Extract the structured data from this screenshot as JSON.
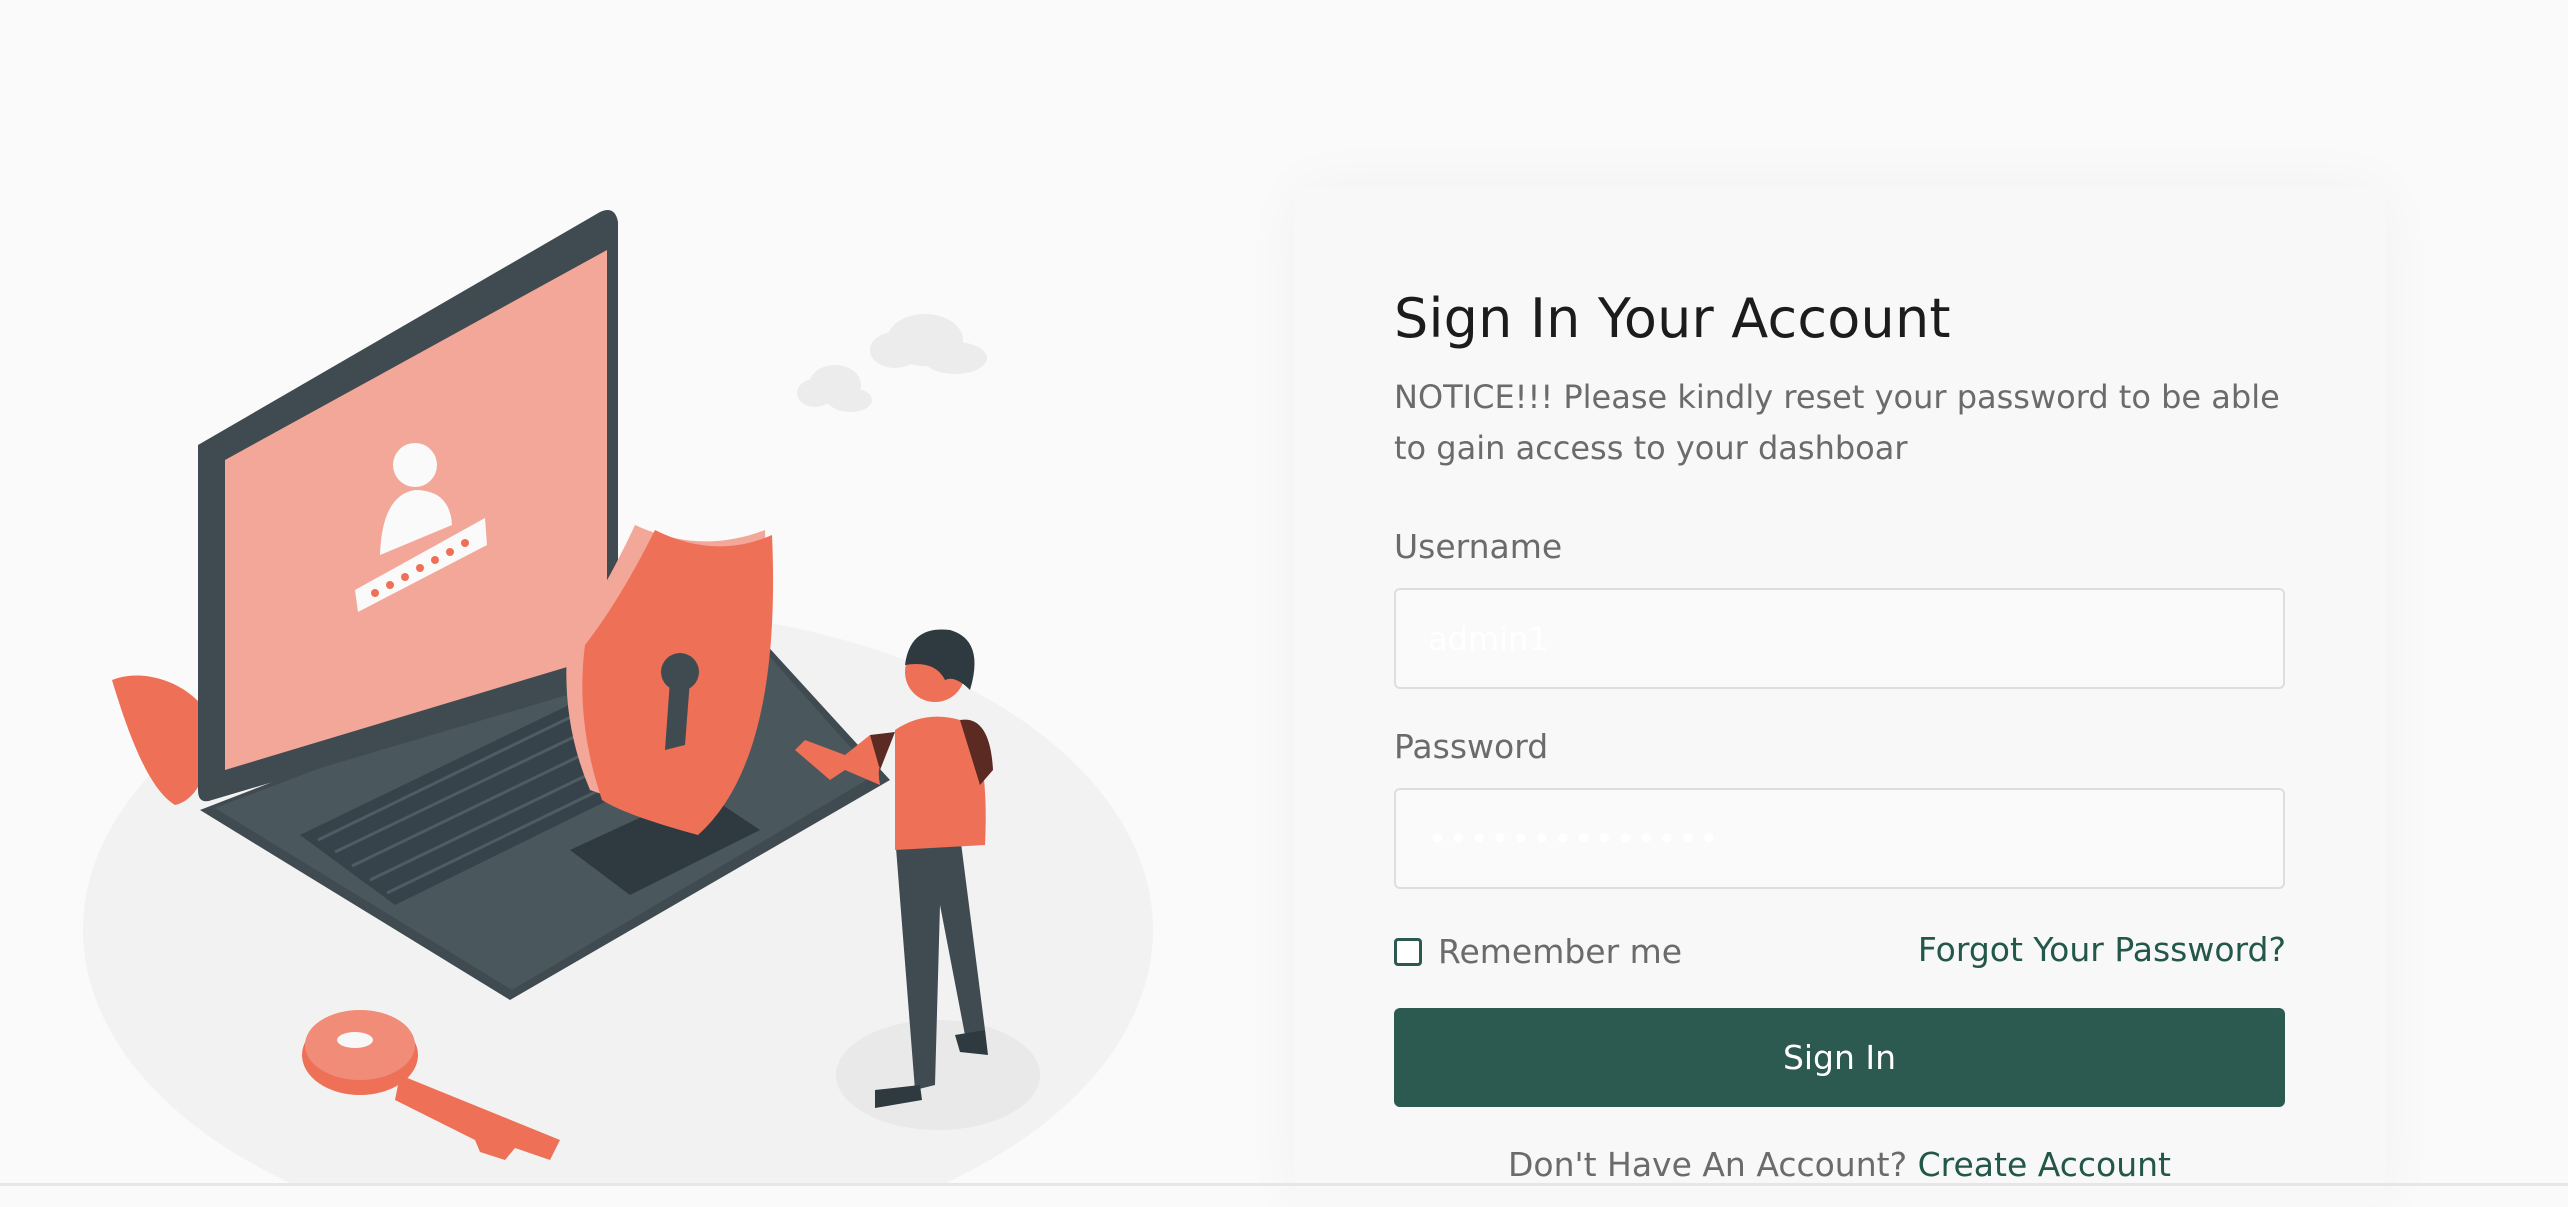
{
  "login": {
    "title": "Sign In Your Account",
    "notice": "NOTICE!!! Please kindly reset your password to be able to gain access to your dashboar",
    "username_label": "Username",
    "username_value": "admin1",
    "password_label": "Password",
    "password_value": "••••••••••••••",
    "remember_label": "Remember me",
    "forgot_label": "Forgot Your Password?",
    "signin_label": "Sign In",
    "signup_prompt": "Don't Have An Account?",
    "signup_link": "Create Account"
  },
  "colors": {
    "accent": "#2d5a50",
    "link": "#23574a",
    "illustration_primary": "#ee7057",
    "illustration_dark": "#3f4b51"
  },
  "icons": {
    "illustration": "security-login-illustration"
  }
}
